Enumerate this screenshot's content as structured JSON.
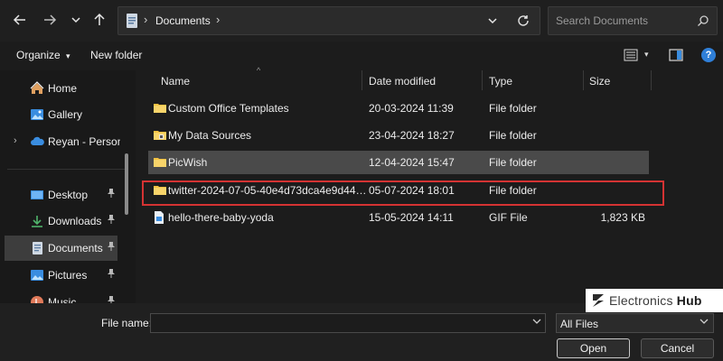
{
  "nav": {
    "back_icon": "back-arrow-icon",
    "forward_icon": "forward-arrow-icon",
    "recent_icon": "chevron-down-icon",
    "up_icon": "up-arrow-icon"
  },
  "address": {
    "path": "Documents",
    "separator": "›"
  },
  "search": {
    "placeholder": "Search Documents"
  },
  "commands": {
    "organize": "Organize",
    "organize_caret": "▾",
    "new_folder": "New folder",
    "view_caret": "▾",
    "help": "?"
  },
  "sidebar": {
    "items": [
      {
        "label": "Home",
        "icon": "home-icon"
      },
      {
        "label": "Gallery",
        "icon": "gallery-icon"
      },
      {
        "label": "Reyan - Persona",
        "icon": "cloud-icon"
      },
      {
        "label": "Desktop",
        "icon": "desktop-icon",
        "pinned": true
      },
      {
        "label": "Downloads",
        "icon": "download-icon",
        "pinned": true
      },
      {
        "label": "Documents",
        "icon": "document-icon",
        "pinned": true,
        "selected": true
      },
      {
        "label": "Pictures",
        "icon": "pictures-icon",
        "pinned": true
      },
      {
        "label": "Music",
        "icon": "music-icon",
        "pinned": true
      }
    ],
    "pin_glyph": "📌"
  },
  "columns": {
    "name": "Name",
    "date": "Date modified",
    "type": "Type",
    "size": "Size",
    "sort_glyph": "^"
  },
  "files": [
    {
      "name": "Custom Office Templates",
      "date": "20-03-2024 11:39",
      "type": "File folder",
      "size": "",
      "icon": "folder-icon"
    },
    {
      "name": "My Data Sources",
      "date": "23-04-2024 18:27",
      "type": "File folder",
      "size": "",
      "icon": "folder-data-icon"
    },
    {
      "name": "PicWish",
      "date": "12-04-2024 15:47",
      "type": "File folder",
      "size": "",
      "icon": "folder-icon",
      "selected": true
    },
    {
      "name": "twitter-2024-07-05-40e4d73dca4e9d442...",
      "date": "05-07-2024 18:01",
      "type": "File folder",
      "size": "",
      "icon": "folder-icon",
      "highlighted": true
    },
    {
      "name": "hello-there-baby-yoda",
      "date": "15-05-2024 14:11",
      "type": "GIF File",
      "size": "1,823 KB",
      "icon": "gif-file-icon"
    }
  ],
  "bottom": {
    "filename_label": "File name:",
    "filename_value": "",
    "filetype_value": "All Files",
    "open": "Open",
    "cancel": "Cancel",
    "chevron": "⌄"
  },
  "watermark": {
    "text_a": "Electronics ",
    "text_b": "Hub"
  },
  "colors": {
    "highlight_box": "#d43333",
    "folder": "#f5c242",
    "accent_blue": "#3a8de0"
  }
}
